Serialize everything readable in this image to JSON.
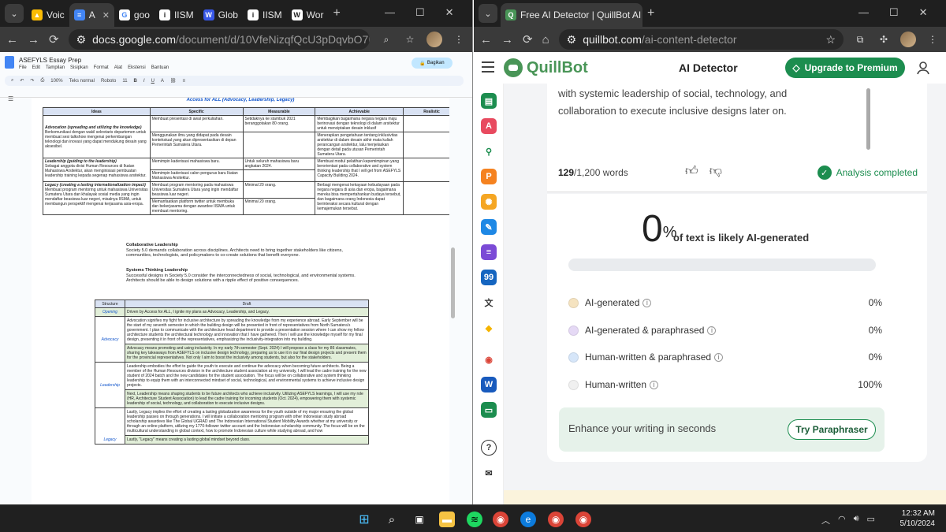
{
  "left_window": {
    "tabs": [
      {
        "label": "Voic",
        "icon": "google-drive-icon",
        "color": "#fbbc04"
      },
      {
        "label": "A",
        "icon": "google-docs-icon",
        "color": "#4285f4",
        "active": true
      },
      {
        "label": "goo",
        "icon": "google-icon",
        "color": "#ffffff"
      },
      {
        "label": "IISM",
        "icon": "info-icon",
        "color": "#222222"
      },
      {
        "label": "Glob",
        "icon": "wordpress-icon",
        "color": "#3858e9"
      },
      {
        "label": "IISM",
        "icon": "info-icon",
        "color": "#222222"
      },
      {
        "label": "Wor",
        "icon": "w-icon",
        "color": "#333333"
      }
    ],
    "url_domain": "docs.google.com",
    "url_path": "/document/d/10VfeNizqfQcU3pDqvbO7LqRGoCBAnpj...",
    "doc_title": "ASEFYLS Essay Prep",
    "menu": [
      "File",
      "Edit",
      "Tampilan",
      "Sisipkan",
      "Format",
      "Alat",
      "Ekstensi",
      "Bantuan"
    ],
    "share_label": "Bagikan",
    "format_bar": {
      "zoom": "100%",
      "style": "Teks normal",
      "font": "Roboto",
      "size": "11"
    },
    "page_title": "Access for ALL (Advocacy, Leadership, Legacy)",
    "table1": {
      "headers": [
        "Ideas",
        "Specific",
        "Measurable",
        "Achievable",
        "Realistic"
      ],
      "rows": [
        {
          "idea_title": "Advocation (spreading and utilizing the knowledge)",
          "idea": "Berkomunikasi dengan wakil sekretaris departemen untuk membuat sesi talkshow mengenai perkembangan teknologi dan inovasi yang dapat mendukung desain yang aksesibel.",
          "specific": "Membuat presentasi di awal perkuliahan.",
          "measurable": "Setidaknya ke stambuk 2021 beranggotakan 80 orang.",
          "achievable": "Membagikan bagaimana negara negara maju berinovasi dengan teknologi di dalam arsitektur untuk menciptakan desain inklusif"
        },
        {
          "idea_title": "",
          "idea": "",
          "specific": "Menggunakan ilmu yang didapat pada desain kontekstual yang akan dipresentasikan di depan Pemerintah Sumatera Utara.",
          "measurable": "",
          "achievable": "Menerapkan pengetahuan tentang inklusivitas arsitektur di dalam desain akhir mata kuliah perancangan arsitektur, lalu menjelaskan dengan detail pada utusan Pemerintah Sumatera Utara."
        },
        {
          "idea_title": "Leadership (guiding to the leadership)",
          "idea": "Sebagai anggota divisi Human Resources di Ikatan Mahasiswa Arsitektur, akan menginisiasi pembuatan leadership training kepada segenap mahasiswa arsitektur.",
          "specific": "Memimpin kaderisasi mahasiswa baru.",
          "measurable": "Untuk seluruh mahasiswa baru angkatan 2024.",
          "achievable": "Membuat modul pelatihan kepemimpinan yang berorientasi pada collaborative and system thinking leadership that I will get from ASEFYLS Capacity Building 2024."
        },
        {
          "idea_title": "",
          "idea": "",
          "specific": "Memimpin kaderisasi calon pengurus baru Ikatan Mahasiswa Arsitektur.",
          "measurable": "",
          "achievable": ""
        },
        {
          "idea_title": "Legacy (creating a lasting internationalization impact)",
          "idea": "Membuat program mentoring untuk mahasiswa Universitas Sumatera Utara dan khalayak sosial media yang ingin mendaftar beasiswa luar negeri, misalnya IISMA, untuk membangun perspektif mengenai kerjasama asia-eropa.",
          "specific": "Membuat program mentoring pada mahasiswa Universitas Sumatera Utara yang ingin mendaftar beasiswa luar negeri.",
          "measurable": "Minimal 20 orang.",
          "achievable": "Berbagi mengenai kekayaan kebudayaan pada negara negara di asia dan eropa, bagaimana mereka bisa mempertahankan budaya tersebut, dan bagaimana orang Indonesia dapat berinteraksi secara kultural dengan kemajemukan tersebut."
        },
        {
          "idea_title": "",
          "idea": "",
          "specific": "Memanfaatkan platform twitter untuk membuka dan bekerjasama dengan awardee IISMA untuk membuat mentoring.",
          "measurable": "Minimal 20 orang.",
          "achievable": ""
        }
      ]
    },
    "collab_heading": "Collaborative Leadership",
    "collab_text": "Society 5.0 demands collaboration across disciplines. Architects need to bring together stakeholders like citizens, communities, technologists, and policymakers to co-create solutions that benefit everyone.",
    "systems_heading": "Systems Thinking Leadership",
    "systems_text": "Successful designs in Society 5.0 consider the interconnectedness of social, technological, and environmental systems. Architects should be able to design solutions with a ripple effect of positive consequences.",
    "table2": {
      "headers": [
        "Structure",
        "Draft"
      ],
      "opening_label": "Opening",
      "opening": "Driven by Access for ALL, I ignite my plans as Advocacy, Leadership, and Legacy.",
      "advocacy_label": "Advocacy",
      "advocacy1": "Advocation signifies my fight for inclusive architecture by spreading the knowledge from my experience abroad. Early September will be the start of my seventh semester in which the building design will be presented in front of representatives from North Sumatera's government. I plan to communicate with the architecture head department to provide a presentation session where I can show my fellow architecture students the architectural technology and innovation that I have gathered. Then I will use the knowledge myself for my final design, presenting it in front of the representatives, emphasizing the inclusivity-integration into my building.",
      "advocacy2": "Advocacy means promoting and using inclusivity. In my early 7th semester (Sept. 2024) I will propose a class for my 86 classmates, sharing key takeaways from ASEFYLS on inclusive design technology, preparing us to use it in our final design projects and present them for the provincial representatives. Not only I aim to boost the inclusivity among students, but also for the stakeholders.",
      "leadership_label": "Leadership",
      "leadership1": "Leadership embodies the effort to guide the youth to execute and continue the advocacy when becoming future architects. Being a member of the Human Resources division in the architecture student association at my university, I will lead the cadre training for the new student of 2024 batch and the new candidates for the student association. The focus will be on collaborative and system thinking leadership to equip them with an interconnected mindset of social, technological, and environmental systems to achieve inclusive design projects.",
      "leadership2": "Next, Leadership means shaping students to be future architects who achieve inclusivity. Utilizing ASEFYLS learnings, I will use my role (HR, Architecture Student Association) to lead the cadre training for incoming students (Oct. 2024), empowering them with systemic leadership of social, technology, and collaboration to execute inclusive designs.",
      "legacy_label": "Legacy",
      "legacy1": "Lastly, Legacy implies the effort of creating a lasting globalization awareness for the youth outside of my major ensuring the global leadership passes on through generations. I will initiate a collaboration mentoring program with other Indonesian study abroad scholarship awardees like The Global UGRAD and The Indonesian International Student Mobility Awards whether at my university or through an online platform, utilizing my 1770-follower twitter account and the Indonesian scholarship community. The focus will be on the multicultural understanding in global context, how to promote Indonesian culture while studying abroad, and how",
      "legacy2": "Lastly, \"Legacy\" means creating a lasting global mindset beyond class."
    }
  },
  "right_window": {
    "tab_title": "Free AI Detector | QuillBot AI",
    "url_domain": "quillbot.com",
    "url_path": "/ai-content-detector",
    "brand": "QuillBot",
    "page_title": "AI Detector",
    "premium_label": "Upgrade to Premium",
    "input_text": "with systemic leadership of social, technology, and collaboration to execute inclusive designs later on.",
    "word_count": "129",
    "word_limit": "/1,200 words",
    "analysis_status": "Analysis completed",
    "percent": "0",
    "percent_sign": "%",
    "percent_label": "of text is likely AI-generated",
    "ai_fraction": 0,
    "legend": [
      {
        "label": "AI-generated",
        "value": "0%",
        "color": "#f5e3c0"
      },
      {
        "label": "AI-generated & paraphrased",
        "value": "0%",
        "color": "#e5d9f5"
      },
      {
        "label": "Human-written & paraphrased",
        "value": "0%",
        "color": "#d6e6f9"
      },
      {
        "label": "Human-written",
        "value": "100%",
        "color": "#f0f0f0"
      }
    ],
    "enhance_text": "Enhance your writing in seconds",
    "try_label": "Try Paraphraser"
  },
  "taskbar": {
    "time": "12:32 AM",
    "date": "5/10/2024"
  }
}
